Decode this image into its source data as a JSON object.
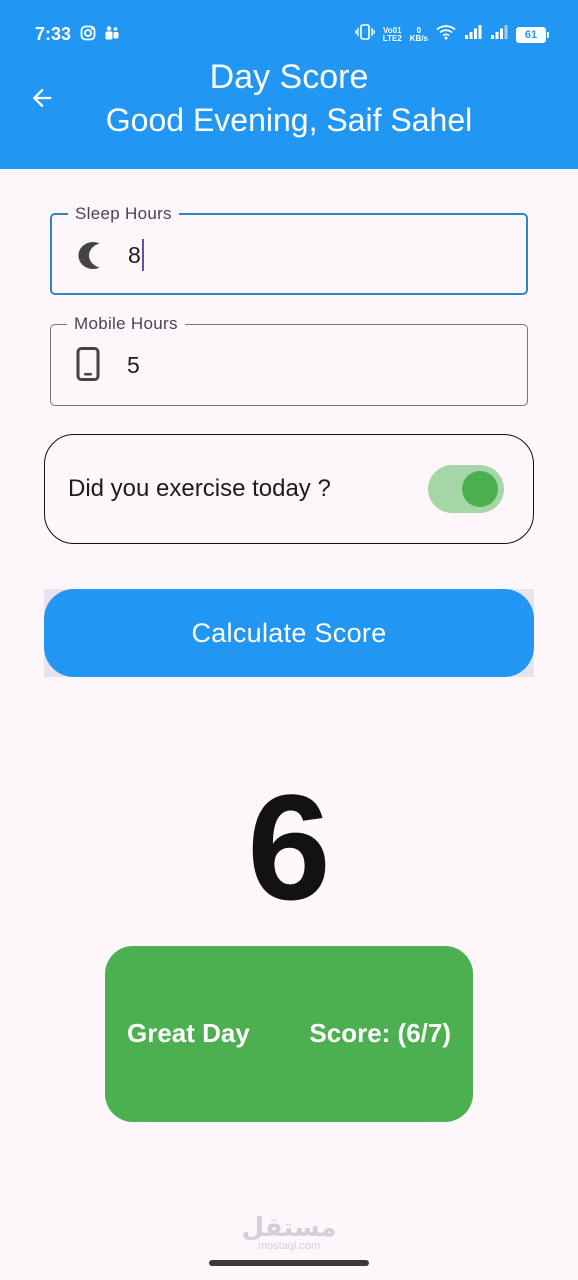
{
  "status_bar": {
    "time": "7:33",
    "network_top": "Vo01",
    "network_bottom": "LTE2",
    "speed_top": "0",
    "speed_bottom": "KB/s",
    "battery": "61"
  },
  "appbar": {
    "title": "Day Score",
    "subtitle": "Good Evening, Saif Sahel",
    "back_icon": "arrow-back-icon",
    "color": "#2196f3"
  },
  "form": {
    "sleep": {
      "label": "Sleep Hours",
      "value": "8",
      "icon": "moon-icon"
    },
    "mobile": {
      "label": "Mobile Hours",
      "value": "5",
      "icon": "smartphone-icon"
    },
    "exercise": {
      "label": "Did you exercise today ?",
      "checked": true
    }
  },
  "calculate_button": {
    "label": "Calculate Score"
  },
  "result": {
    "score": "6",
    "verdict": "Great Day",
    "score_text": "Score: (6/7)",
    "color": "#4caf50"
  },
  "watermark": {
    "arabic": "مستقل",
    "latin": "mostaql.com"
  }
}
